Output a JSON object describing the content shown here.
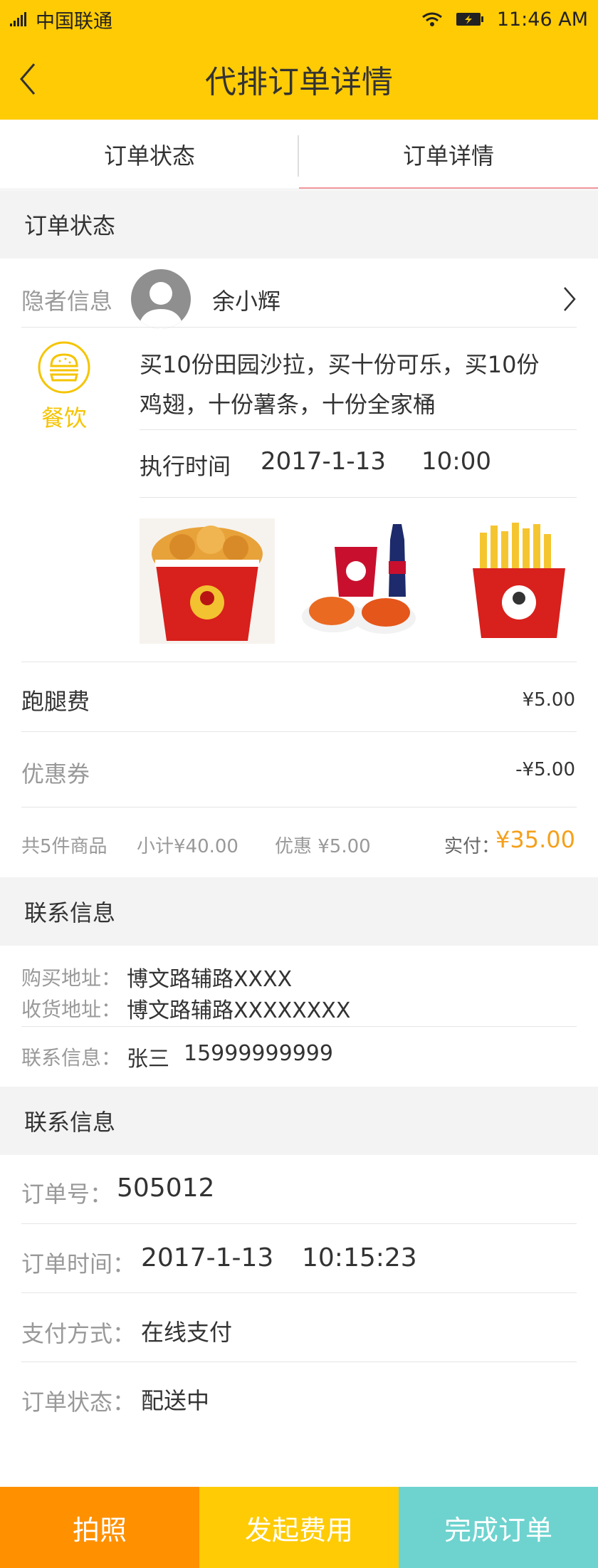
{
  "status_bar": {
    "carrier": "中国联通",
    "time": "11:46 AM"
  },
  "header": {
    "title": "代排订单详情"
  },
  "tabs": [
    {
      "label": "订单状态"
    },
    {
      "label": "订单详情"
    }
  ],
  "sections": {
    "order_status": "订单状态",
    "contact_info": "联系信息",
    "contact_info_2": "联系信息"
  },
  "hermit": {
    "label": "隐者信息",
    "name": "余小辉"
  },
  "category": {
    "label": "餐饮",
    "icon": "burger-icon"
  },
  "order": {
    "description": "买10份田园沙拉，买十份可乐，买10份鸡翅，十份薯条，十份全家桶",
    "description_line1": "买10份田园沙拉，买十份可乐，买10份",
    "description_line2": "鸡翅，十份薯条，十份全家桶",
    "exec_label": "执行时间",
    "exec_date": "2017-1-13",
    "exec_time": "10:00"
  },
  "fees": {
    "run_fee_label": "跑腿费",
    "run_fee": "¥5.00",
    "coupon_label": "优惠券",
    "coupon": "-¥5.00"
  },
  "summary": {
    "count": "共5件商品",
    "subtotal": "小计¥40.00",
    "discount": "优惠 ¥5.00",
    "paid_label": "实付：",
    "paid": "¥35.00"
  },
  "contact": {
    "buy_label": "购买地址：",
    "buy_addr": "博文路辅路XXXX",
    "recv_label": "收货地址：",
    "recv_addr": "博文路辅路XXXXXXXX",
    "info_label": "联系信息：",
    "info_name": "张三",
    "info_phone": "15999999999"
  },
  "details": {
    "no_label": "订单号：",
    "no": "505012",
    "time_label": "订单时间：",
    "date": "2017-1-13",
    "time": "10:15:23",
    "pay_label": "支付方式：",
    "pay": "在线支付",
    "state_label": "订单状态：",
    "state": "配送中"
  },
  "actions": {
    "photo": "拍照",
    "fee": "发起费用",
    "complete": "完成订单"
  },
  "colors": {
    "brand_yellow": "#ffcb05",
    "orange": "#ff9000",
    "teal": "#6ed3cf",
    "price_orange": "#f5a01a"
  }
}
